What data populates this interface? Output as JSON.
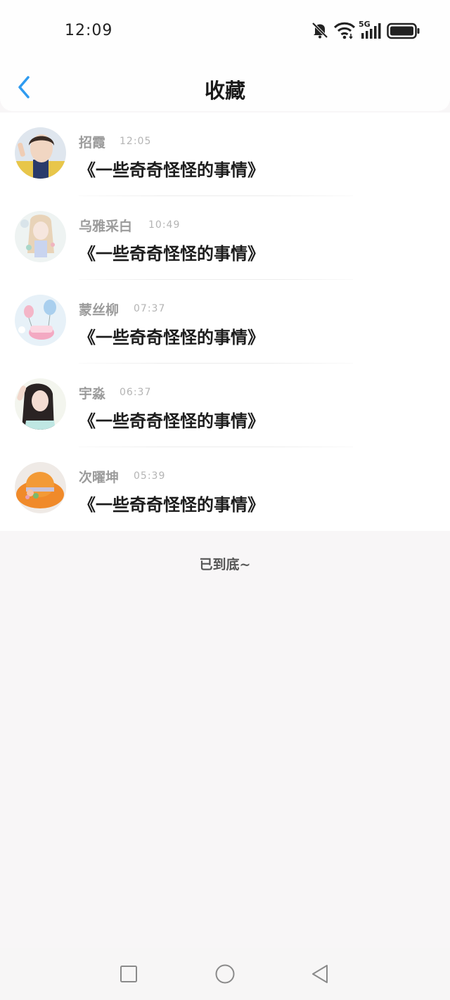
{
  "status_bar": {
    "time": "12:09",
    "network_label": "5G",
    "icons": [
      "bell-muted-icon",
      "wifi-icon",
      "signal-icon",
      "battery-icon"
    ]
  },
  "header": {
    "title": "收藏",
    "back_icon": "chevron-left-icon",
    "accent_color": "#2f9bf0"
  },
  "favorites": [
    {
      "user": "招霞",
      "time": "12:05",
      "title": "《一些奇奇怪怪的事情》"
    },
    {
      "user": "乌雅采白",
      "time": "10:49",
      "title": "《一些奇奇怪怪的事情》"
    },
    {
      "user": "蒙丝柳",
      "time": "07:37",
      "title": "《一些奇奇怪怪的事情》"
    },
    {
      "user": "宇淼",
      "time": "06:37",
      "title": "《一些奇奇怪怪的事情》"
    },
    {
      "user": "次曜坤",
      "time": "05:39",
      "title": "《一些奇奇怪怪的事情》"
    }
  ],
  "footer": {
    "end_text": "已到底~"
  },
  "nav_bar": {
    "buttons": [
      "recent-apps-icon",
      "home-icon",
      "back-triangle-icon"
    ]
  }
}
